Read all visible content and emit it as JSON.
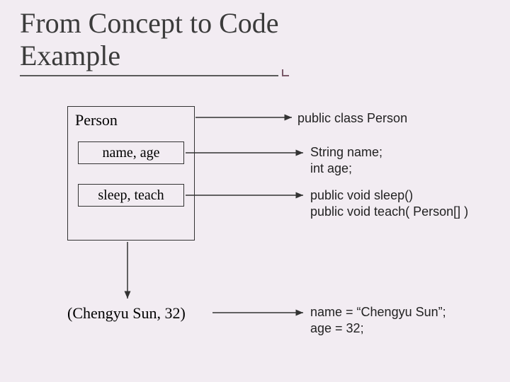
{
  "title_line1": "From Concept to Code",
  "title_line2": "Example",
  "uml": {
    "class_name": "Person",
    "attributes": "name, age",
    "methods": "sleep, teach",
    "instance": "(Chengyu Sun, 32)"
  },
  "code": {
    "class_decl": "public class Person",
    "fields": "String name;\nint age;",
    "methods": "public void sleep()\npublic void teach( Person[] )",
    "instance_assign": "name = “Chengyu Sun”;\nage = 32;"
  }
}
